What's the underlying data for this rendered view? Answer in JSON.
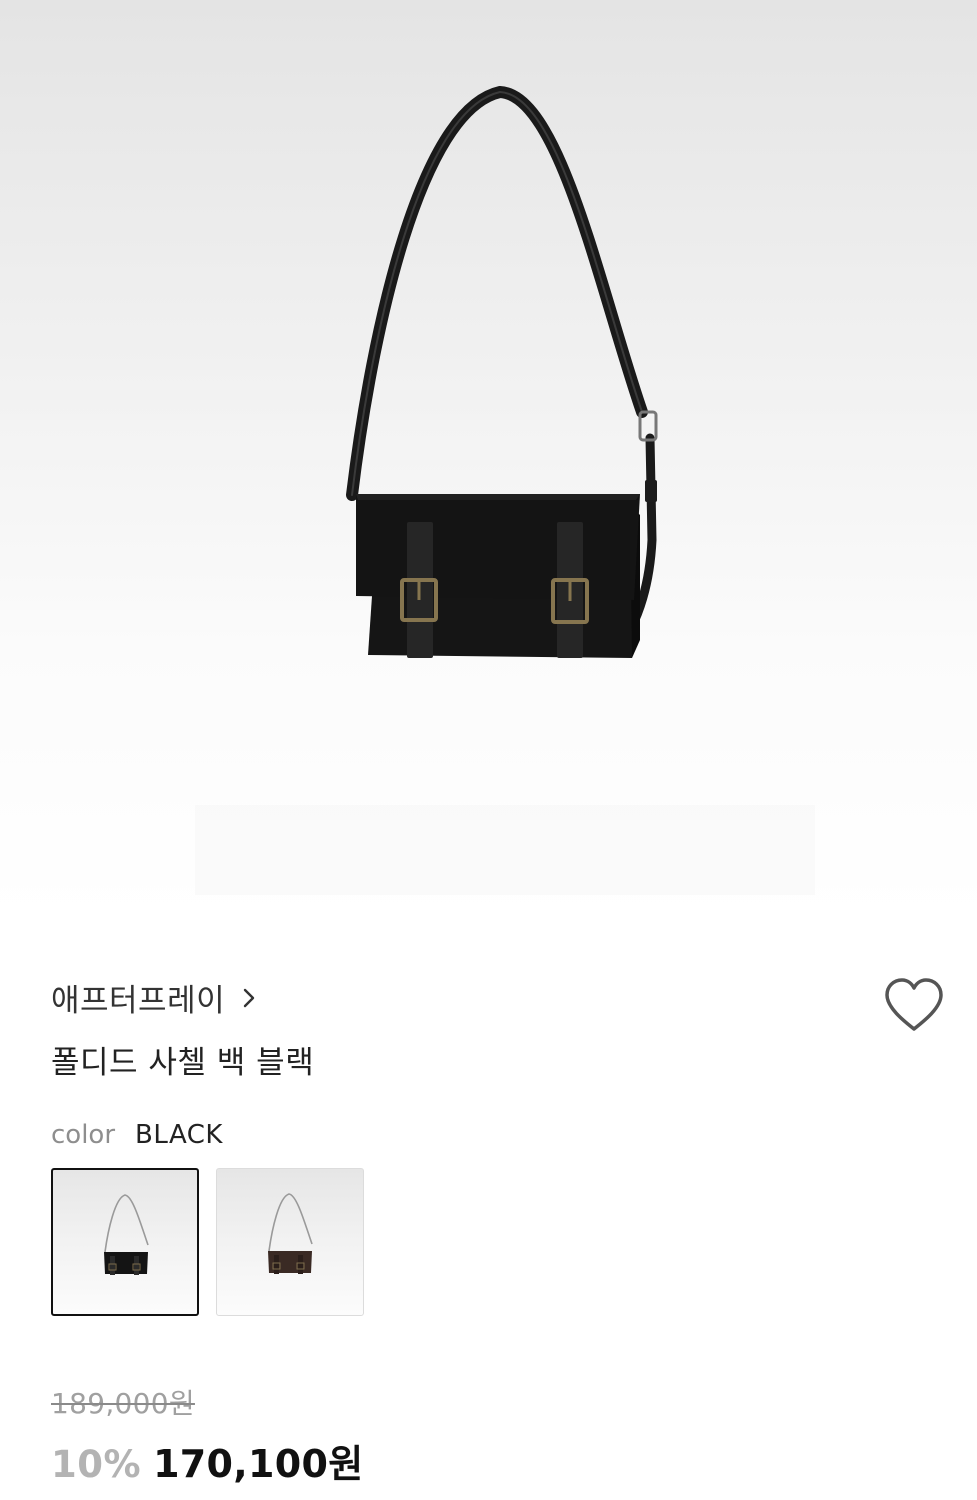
{
  "product": {
    "brand": "애프터프레이",
    "name": "폴디드 사첼 백 블랙"
  },
  "color_option": {
    "label": "color",
    "selected": "BLACK",
    "swatches": [
      {
        "name": "black",
        "color": "#111111",
        "selected": true
      },
      {
        "name": "brown",
        "color": "#3a2a24",
        "selected": false
      }
    ]
  },
  "pricing": {
    "original": "189,000원",
    "discount": "10%",
    "final": "170,100원"
  },
  "icons": {
    "brand_link": "chevron-right-icon",
    "wishlist": "heart-outline-icon"
  },
  "colors": {
    "bag": "#121212",
    "strap_leather": "#2a2a2a",
    "buckle": "#8a7650",
    "text_primary": "#222222",
    "text_muted": "#8e8e8e"
  }
}
